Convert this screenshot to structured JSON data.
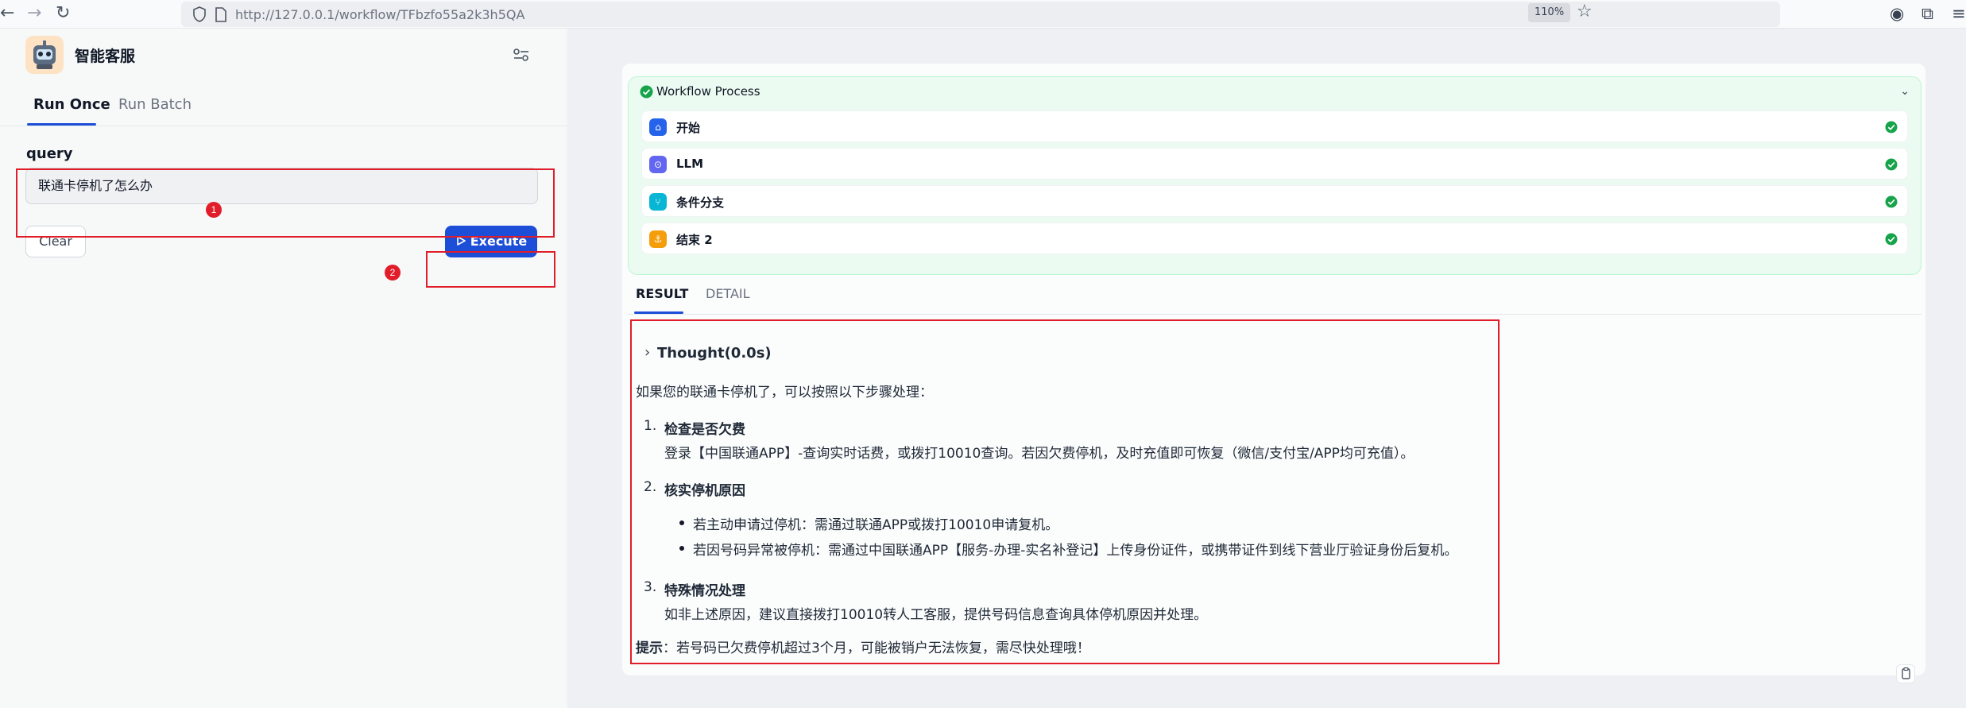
{
  "browser": {
    "url": "http://127.0.0.1/workflow/TFbzfo55a2k3h5QA",
    "zoom": "110%"
  },
  "app": {
    "name": "智能客服"
  },
  "tabs": {
    "run_once": "Run Once",
    "run_batch": "Run Batch"
  },
  "form": {
    "query_label": "query",
    "query_value": "联通卡停机了怎么办",
    "clear_label": "Clear",
    "execute_label": "Execute"
  },
  "annotations": {
    "marker1": "1",
    "marker2": "2",
    "highlight_color": "#e11d2a"
  },
  "workflow": {
    "title": "Workflow Process",
    "nodes": [
      {
        "label": "开始",
        "icon": "home-icon",
        "color": "#2563eb"
      },
      {
        "label": "LLM",
        "icon": "llm-icon",
        "color": "#6366f1"
      },
      {
        "label": "条件分支",
        "icon": "branch-icon",
        "color": "#06b6d4"
      },
      {
        "label": "结束 2",
        "icon": "end-icon",
        "color": "#f59e0b"
      }
    ]
  },
  "result_tabs": {
    "result": "RESULT",
    "detail": "DETAIL"
  },
  "result": {
    "thought": "Thought(0.0s)",
    "intro": "如果您的联通卡停机了，可以按照以下步骤处理：",
    "step1_title": "检查是否欠费",
    "step1_text": "登录【中国联通APP】-查询实时话费，或拨打10010查询。若因欠费停机，及时充值即可恢复（微信/支付宝/APP均可充值）。",
    "step2_title": "核实停机原因",
    "step2_bullet1": "若主动申请过停机：需通过联通APP或拨打10010申请复机。",
    "step2_bullet2": "若因号码异常被停机：需通过中国联通APP【服务-办理-实名补登记】上传身份证件，或携带证件到线下营业厅验证身份后复机。",
    "step3_title": "特殊情况处理",
    "step3_text": "如非上述原因，建议直接拨打10010转人工客服，提供号码信息查询具体停机原因并处理。",
    "tip_label": "提示",
    "tip_text": "：若号码已欠费停机超过3个月，可能被销户无法恢复，需尽快处理哦！"
  },
  "colors": {
    "accent": "#1d4ed8",
    "success": "#16a34a"
  }
}
